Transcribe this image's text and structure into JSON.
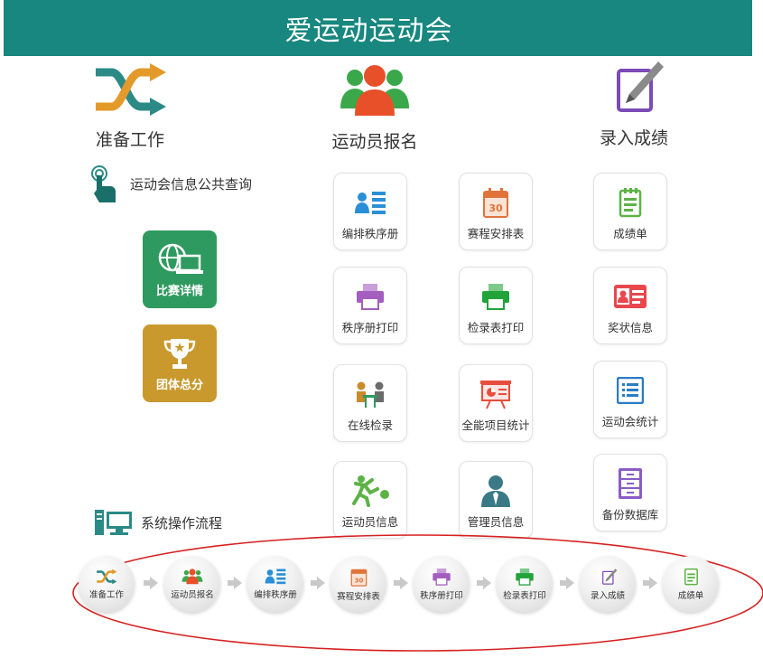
{
  "header": {
    "title": "爱运动运动会"
  },
  "columns": {
    "prep": {
      "label": "准备工作",
      "icon": "shuffle-icon"
    },
    "register": {
      "label": "运动员报名",
      "icon": "athletes-group-icon"
    },
    "scores": {
      "label": "录入成绩",
      "icon": "edit-pen-icon"
    }
  },
  "query": {
    "label": "运动会信息公共查询",
    "icon": "touch-hand-icon"
  },
  "big_buttons": [
    {
      "label": "比赛详情",
      "icon": "globe-monitor-icon",
      "color": "#2f9a5f"
    },
    {
      "label": "团体总分",
      "icon": "trophy-icon",
      "color": "#c9992e"
    }
  ],
  "tiles": [
    {
      "label": "编排秩序册",
      "icon": "id-list-icon"
    },
    {
      "label": "赛程安排表",
      "icon": "calendar-30-icon"
    },
    {
      "label": "成绩单",
      "icon": "notepad-icon"
    },
    {
      "label": "秩序册打印",
      "icon": "printer-purple-icon"
    },
    {
      "label": "检录表打印",
      "icon": "printer-green-icon"
    },
    {
      "label": "奖状信息",
      "icon": "id-card-icon"
    },
    {
      "label": "在线检录",
      "icon": "meeting-icon"
    },
    {
      "label": "全能项目统计",
      "icon": "presentation-chart-icon"
    },
    {
      "label": "运动会统计",
      "icon": "list-doc-icon"
    },
    {
      "label": "运动员信息",
      "icon": "runner-icon"
    },
    {
      "label": "管理员信息",
      "icon": "admin-user-icon"
    },
    {
      "label": "备份数据库",
      "icon": "cabinet-icon"
    }
  ],
  "flow": {
    "title": "系统操作流程",
    "icon": "computer-icon",
    "steps": [
      {
        "label": "准备工作",
        "icon": "shuffle-icon"
      },
      {
        "label": "运动员报名",
        "icon": "athletes-group-icon"
      },
      {
        "label": "编排秩序册",
        "icon": "id-list-icon"
      },
      {
        "label": "赛程安排表",
        "icon": "calendar-30-icon"
      },
      {
        "label": "秩序册打印",
        "icon": "printer-purple-icon"
      },
      {
        "label": "检录表打印",
        "icon": "printer-green-icon"
      },
      {
        "label": "录入成绩",
        "icon": "edit-pen-icon"
      },
      {
        "label": "成绩单",
        "icon": "notepad-icon"
      }
    ]
  },
  "colors": {
    "banner": "#17877f",
    "flow_ring": "#d62020"
  }
}
